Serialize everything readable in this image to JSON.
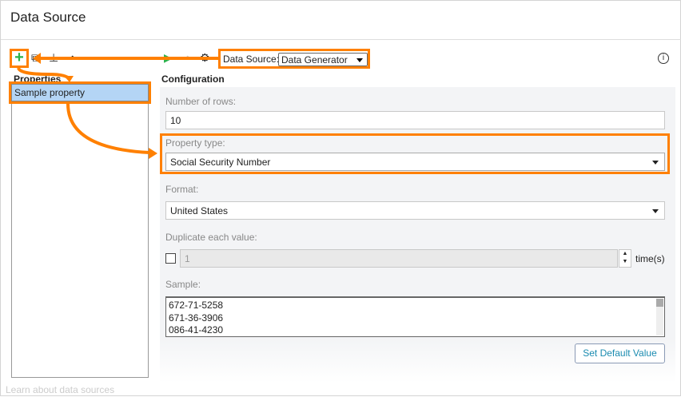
{
  "window": {
    "title": "Data Source"
  },
  "toolbar": {
    "data_source_label": "Data Source:",
    "data_source_value": "Data Generator",
    "info_icon": "i"
  },
  "properties": {
    "heading": "Properties",
    "items": [
      {
        "label": "Sample property",
        "selected": true
      }
    ]
  },
  "configuration": {
    "heading": "Configuration",
    "rows_label": "Number of rows:",
    "rows_value": "10",
    "type_label": "Property type:",
    "type_value": "Social Security Number",
    "format_label": "Format:",
    "format_value": "United States",
    "duplicate_label": "Duplicate each value:",
    "duplicate_value": "1",
    "duplicate_unit": "time(s)",
    "duplicate_checked": false,
    "sample_label": "Sample:",
    "sample_values": [
      "672-71-5258",
      "671-36-3906",
      "086-41-4230"
    ],
    "set_default_label": "Set Default Value"
  },
  "footer": {
    "learn_link": "Learn about data sources"
  },
  "colors": {
    "highlight": "#ff8000",
    "accent_plus": "#2bb24c",
    "selection": "#b4d5f5"
  }
}
